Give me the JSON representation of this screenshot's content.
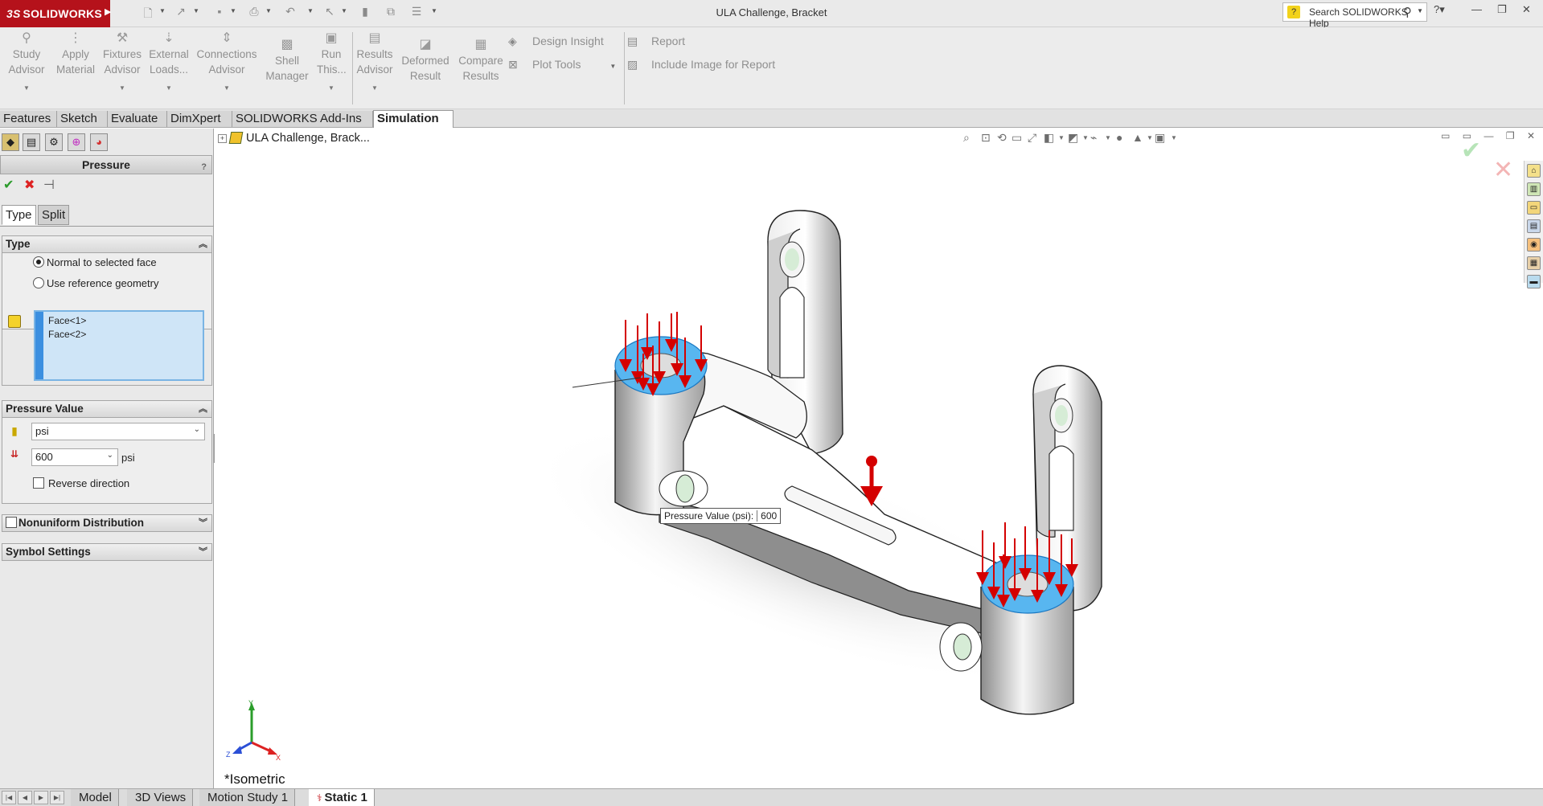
{
  "app": {
    "logo": "SOLIDWORKS",
    "logo_prefix": "3S",
    "document_title": "ULA Challenge, Bracket",
    "search_placeholder": "Search SOLIDWORKS Help"
  },
  "ribbon": {
    "buttons": [
      {
        "label1": "Study",
        "label2": "Advisor"
      },
      {
        "label1": "Apply",
        "label2": "Material"
      },
      {
        "label1": "Fixtures",
        "label2": "Advisor"
      },
      {
        "label1": "External",
        "label2": "Loads..."
      },
      {
        "label1": "Connections",
        "label2": "Advisor"
      },
      {
        "label1": "Shell",
        "label2": "Manager"
      },
      {
        "label1": "Run",
        "label2": "This..."
      },
      {
        "label1": "Results",
        "label2": "Advisor"
      },
      {
        "label1": "Deformed",
        "label2": "Result"
      },
      {
        "label1": "Compare",
        "label2": "Results"
      }
    ],
    "design_insight": "Design Insight",
    "plot_tools": "Plot Tools",
    "report": "Report",
    "include_image": "Include Image for Report"
  },
  "cm_tabs": [
    "Features",
    "Sketch",
    "Evaluate",
    "DimXpert",
    "SOLIDWORKS Add-Ins",
    "Simulation"
  ],
  "property_manager": {
    "title": "Pressure",
    "help": "?",
    "subtabs": [
      "Type",
      "Split"
    ],
    "type_group": {
      "title": "Type",
      "option_normal": "Normal to selected face",
      "option_reference": "Use reference geometry",
      "faces": [
        "Face<1>",
        "Face<2>"
      ]
    },
    "pressure_group": {
      "title": "Pressure Value",
      "unit": "psi",
      "value": "600",
      "value_unit": "psi",
      "reverse": "Reverse direction"
    },
    "nonuniform": "Nonuniform Distribution",
    "symbol_settings": "Symbol Settings"
  },
  "graphics": {
    "tree_root": "ULA Challenge, Brack...",
    "callout_label": "Pressure Value (psi):",
    "callout_value": "600",
    "view_name": "*Isometric",
    "triad": {
      "x": "X",
      "y": "Y",
      "z": "Z"
    }
  },
  "bottom_tabs": [
    "Model",
    "3D Views",
    "Motion Study 1",
    "Static 1"
  ]
}
